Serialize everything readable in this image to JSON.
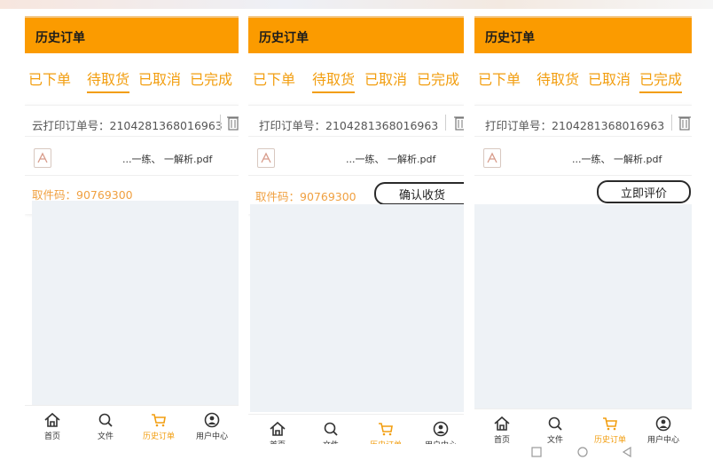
{
  "header": {
    "title": "历史订单"
  },
  "tabs": [
    "已下单",
    "待取货",
    "已取消",
    "已完成"
  ],
  "panels": [
    {
      "active_tab": 1,
      "order_label": "云打印订单号：",
      "order_number": "2104281368016963",
      "file_name": "...一练、 一解析.pdf",
      "pickup_label": "取件码：",
      "pickup_code": "90769300",
      "action": ""
    },
    {
      "active_tab": 1,
      "order_label": "打印订单号：",
      "order_number": "2104281368016963",
      "file_name": "...一练、 一解析.pdf",
      "pickup_label": "取件码：",
      "pickup_code": "90769300",
      "action": "确认收货"
    },
    {
      "active_tab": 3,
      "order_label": "打印订单号：",
      "order_number": "2104281368016963",
      "file_name": "...一练、 一解析.pdf",
      "pickup_label": "",
      "pickup_code": "",
      "action": "立即评价"
    }
  ],
  "bottom_nav": [
    {
      "label": "首页",
      "icon": "home-icon"
    },
    {
      "label": "文件",
      "icon": "search-icon"
    },
    {
      "label": "历史订单",
      "icon": "cart-icon",
      "active": true
    },
    {
      "label": "用户中心",
      "icon": "user-icon"
    }
  ],
  "colors": {
    "accent": "#fb9b00",
    "tab_text": "#f29e10",
    "pickup_text": "#f0a040",
    "gray_area": "#eef2f6"
  },
  "system_nav": [
    "square-icon",
    "circle-icon",
    "back-triangle-icon"
  ]
}
